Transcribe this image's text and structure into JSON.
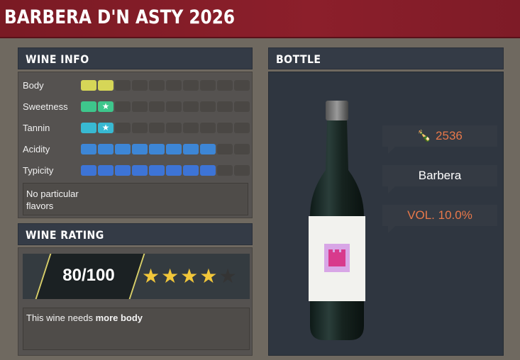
{
  "title": "BARBERA D'N ASTY 2026",
  "wine_info": {
    "heading": "WINE INFO",
    "attributes": [
      {
        "label": "Body",
        "filled": 2,
        "total": 10,
        "color": "#d6d657",
        "star_at": null
      },
      {
        "label": "Sweetness",
        "filled": 2,
        "total": 10,
        "color": "#3ec68c",
        "star_at": 2
      },
      {
        "label": "Tannin",
        "filled": 2,
        "total": 10,
        "color": "#38b9d2",
        "star_at": 2
      },
      {
        "label": "Acidity",
        "filled": 8,
        "total": 10,
        "color": "#3d86d6",
        "star_at": null
      },
      {
        "label": "Typicity",
        "filled": 8,
        "total": 10,
        "color": "#3d74d6",
        "star_at": null
      }
    ],
    "flavors": "No particular flavors"
  },
  "wine_rating": {
    "heading": "WINE RATING",
    "score": "80/100",
    "stars": 4,
    "max_stars": 5,
    "message_prefix": "This wine needs ",
    "message_bold": "more body"
  },
  "bottle": {
    "heading": "BOTTLE",
    "count": "2536",
    "grape": "Barbera",
    "volume": "VOL. 10.0%"
  },
  "colors": {
    "title_bg": "#8c1f2b",
    "panel_head": "#343b46",
    "accent_orange": "#e8784a",
    "star_gold": "#f2c73a"
  },
  "icons": {
    "bottles": "bottles-icon",
    "star": "star-icon",
    "castle_label": "castle-icon"
  }
}
